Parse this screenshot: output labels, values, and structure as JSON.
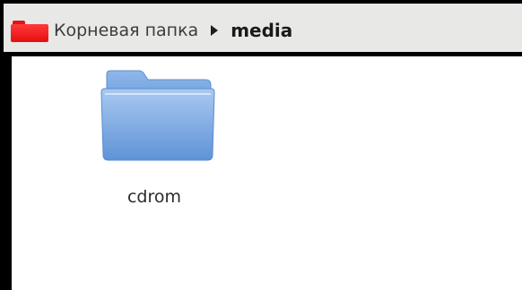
{
  "breadcrumb": {
    "root_label": "Корневая папка",
    "current_label": "media",
    "root_icon": "folder-red-icon",
    "separator_icon": "triangle-right-icon"
  },
  "files": [
    {
      "name": "cdrom",
      "icon": "folder-blue-icon"
    }
  ],
  "colors": {
    "accent_red": "#e40f0f",
    "folder_blue": "#7aa8e3",
    "pathbar_bg": "#e8e8e7",
    "content_bg": "#ffffff"
  }
}
